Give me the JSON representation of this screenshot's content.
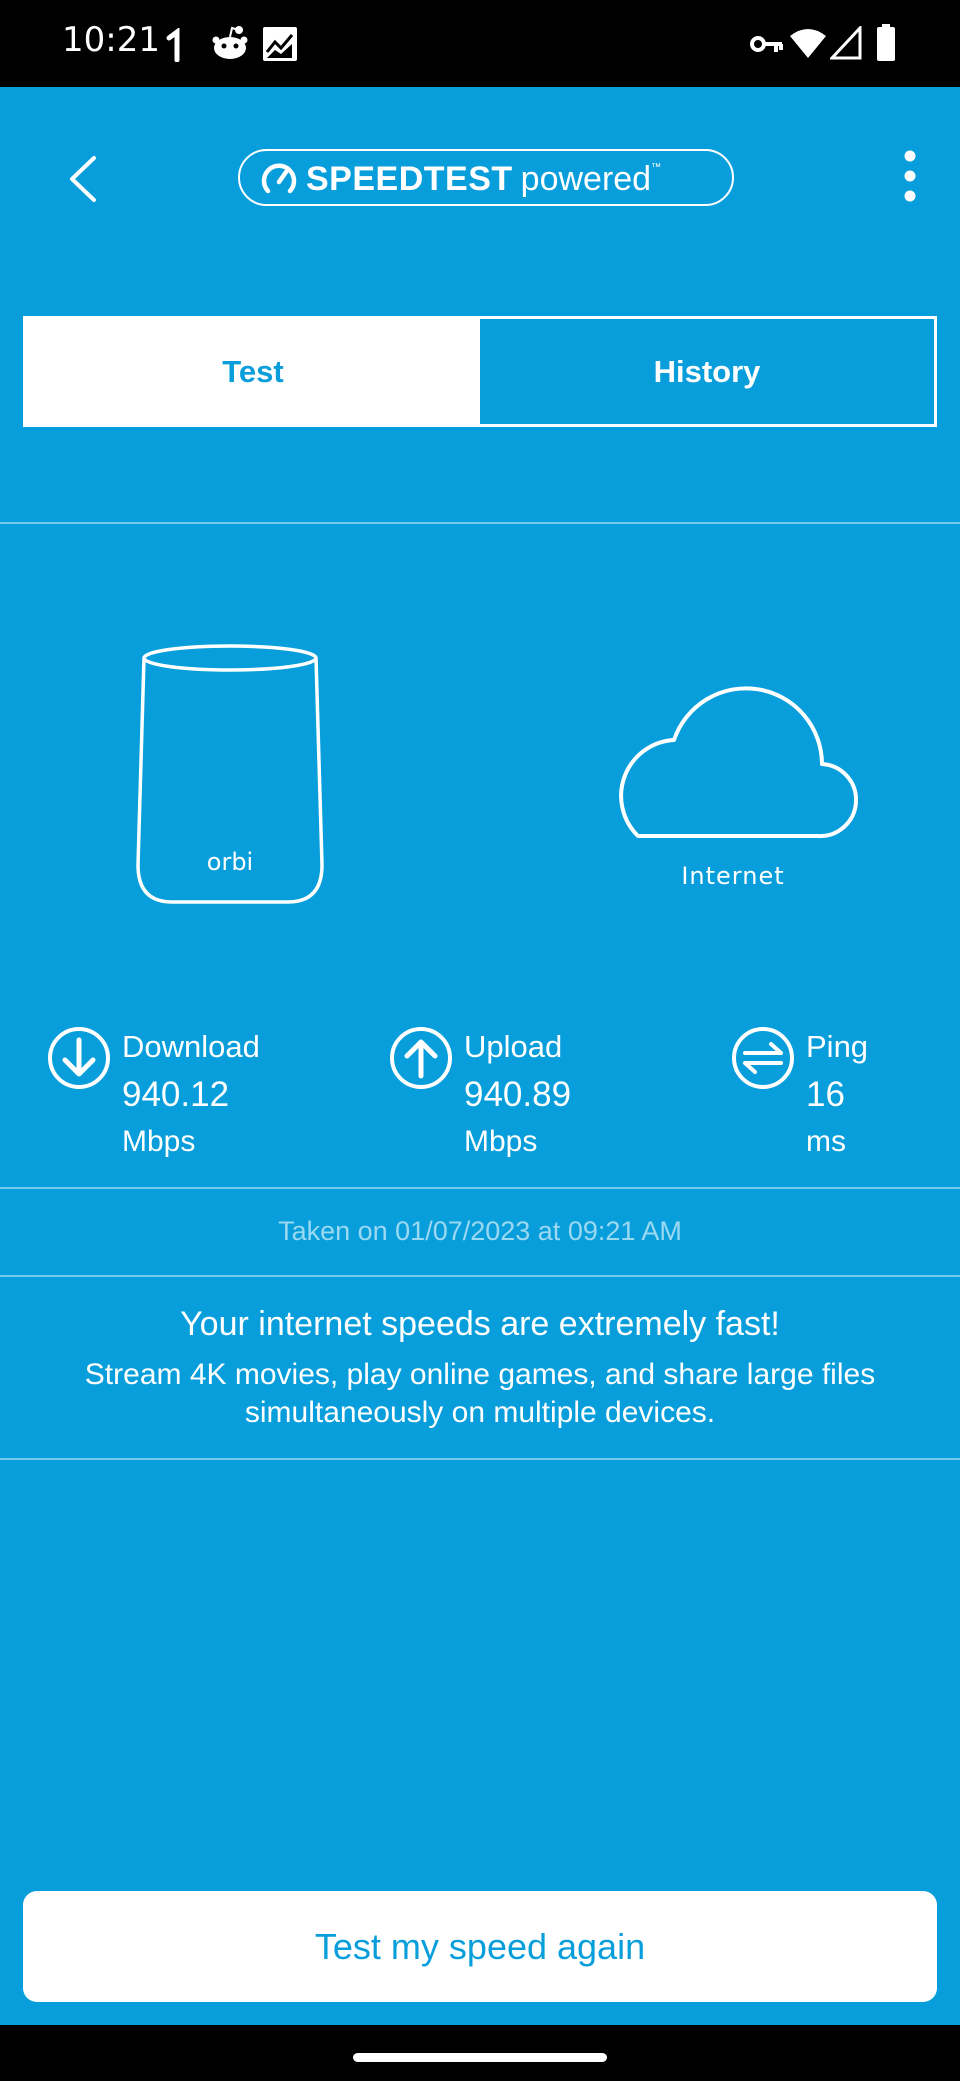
{
  "status_bar": {
    "time": "10:21",
    "left_icons": [
      "signal-arrow-icon",
      "reddit-icon",
      "stocks-icon"
    ],
    "right_icons": [
      "vpn-key-icon",
      "wifi-icon",
      "cellular-icon",
      "battery-icon"
    ]
  },
  "app_bar": {
    "logo_brand": "SPEEDTEST",
    "logo_suffix": "powered",
    "logo_tm": "™"
  },
  "tabs": [
    {
      "label": "Test",
      "selected": true
    },
    {
      "label": "History",
      "selected": false
    }
  ],
  "illustration": {
    "router_label": "orbi",
    "cloud_label": "Internet"
  },
  "stats": {
    "download": {
      "label": "Download",
      "value": "940.12",
      "unit": "Mbps"
    },
    "upload": {
      "label": "Upload",
      "value": "940.89",
      "unit": "Mbps"
    },
    "ping": {
      "label": "Ping",
      "value": "16",
      "unit": "ms"
    }
  },
  "taken_on": "Taken on 01/07/2023 at 09:21 AM",
  "verdict": {
    "title": "Your internet speeds are extremely fast!",
    "description": "Stream 4K movies, play online games, and share large files simultaneously on multiple devices."
  },
  "retest_button": "Test my speed again",
  "colors": {
    "background": "#079edb",
    "text": "#ffffff"
  }
}
